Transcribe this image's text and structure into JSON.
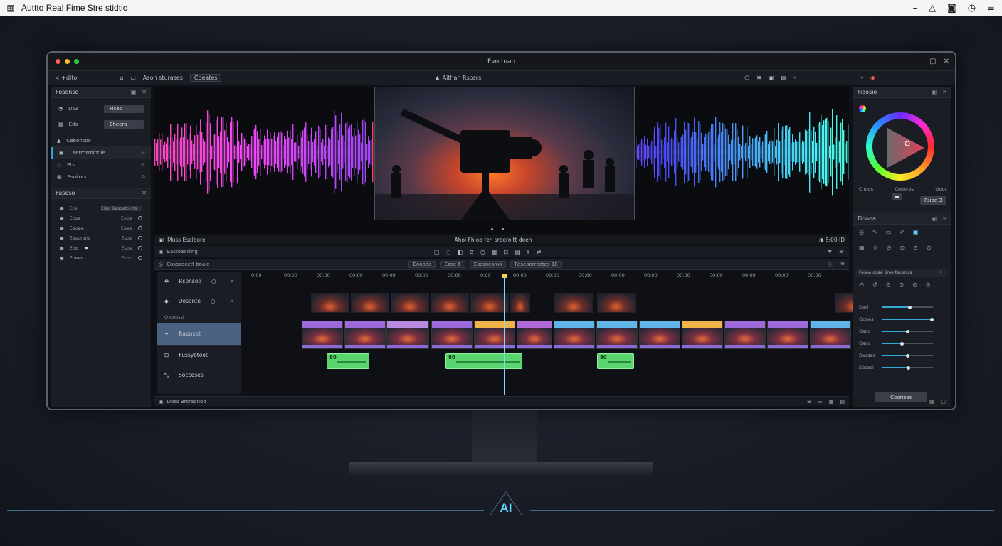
{
  "os": {
    "title": "Auttto Real Fime Stre stidtio",
    "app_icon": "grid-icon"
  },
  "window": {
    "title": "Fvrctoao",
    "traffic_colors": [
      "#ff5f57",
      "#febc2e",
      "#28c840"
    ]
  },
  "toolbar": {
    "back_label": "< +dito",
    "projects_label": "Ason sturases",
    "creates_label": "Coeates",
    "center_label": "Aithan Rsosrs"
  },
  "left_panel": {
    "header": "Fosonso",
    "rows": [
      {
        "icon": "clock-icon",
        "label": "Ds3",
        "value": "Fices"
      },
      {
        "icon": "grid-icon",
        "label": "Eds",
        "value": "Eheera"
      }
    ],
    "list": [
      {
        "label": "Cebonsoo",
        "active": false
      },
      {
        "label": "Csetrosmiotiie",
        "active": true
      },
      {
        "label": "Ets",
        "active": false
      },
      {
        "label": "Esoiiors",
        "active": false
      }
    ],
    "props_header": "Fuseso",
    "props": [
      {
        "label": "Ete",
        "value": "Eissi Besoetoii ts"
      },
      {
        "label": "Ecoe",
        "value": "Eooe"
      },
      {
        "label": "Eeoee",
        "value": "Eaee"
      },
      {
        "label": "Eesorons",
        "value": "Esoe"
      },
      {
        "label": "Eoo",
        "value": "Esoe"
      },
      {
        "label": "Eoees",
        "value": "Ezoo"
      }
    ]
  },
  "timeline": {
    "bar_left": "Muss Eseloore",
    "bar_center": "Ahoi Fhioo ren sreeroitt doen",
    "bar_right": "8:00 ID",
    "sub_left": "Eastoaoding",
    "strip_left": "Cosoceectt boalo",
    "strip_pills": [
      "Eooodo",
      "Ezoe 6",
      "Eossoesroo",
      "Feseoorreotes 18"
    ],
    "ruler": [
      "0:00",
      "00:00",
      "00:00",
      "00:00",
      "00:00",
      "00:00",
      "00:00",
      "0:00",
      "00:00",
      "00:00",
      "00:00",
      "00:00",
      "00:00",
      "00:00",
      "00:00",
      "00:00",
      "00:00",
      "00:00"
    ],
    "tracks": [
      {
        "label": "Rspnsoo",
        "selected": false
      },
      {
        "label": "Dosante",
        "selected": false
      },
      {
        "label": "Rapnsot",
        "selected": true
      },
      {
        "label": "Fussyotoot",
        "selected": false
      },
      {
        "label": "Socceses",
        "selected": false
      }
    ],
    "track_sub": "O onossl",
    "audio_labels": [
      "80",
      "80",
      "80"
    ],
    "bottom": "Doss Brsraonoo"
  },
  "right_panel": {
    "color_header": "Fioosio",
    "color_labels": [
      "Cnoos",
      "Ceoores",
      "Oooc"
    ],
    "apply_label": "Fsioe 3",
    "fx_header": "Fioona",
    "fx_sub": "Fesee ocae Sree tiesasss",
    "sliders": [
      {
        "label": "Dad",
        "value": 0.55
      },
      {
        "label": "Oones",
        "value": 0.98
      },
      {
        "label": "Osoo",
        "value": 0.5
      },
      {
        "label": "Osoo",
        "value": 0.4
      },
      {
        "label": "Dvsses",
        "value": 0.5
      },
      {
        "label": "Sbsesi",
        "value": 0.52
      }
    ],
    "button_label": "Coorioss"
  }
}
